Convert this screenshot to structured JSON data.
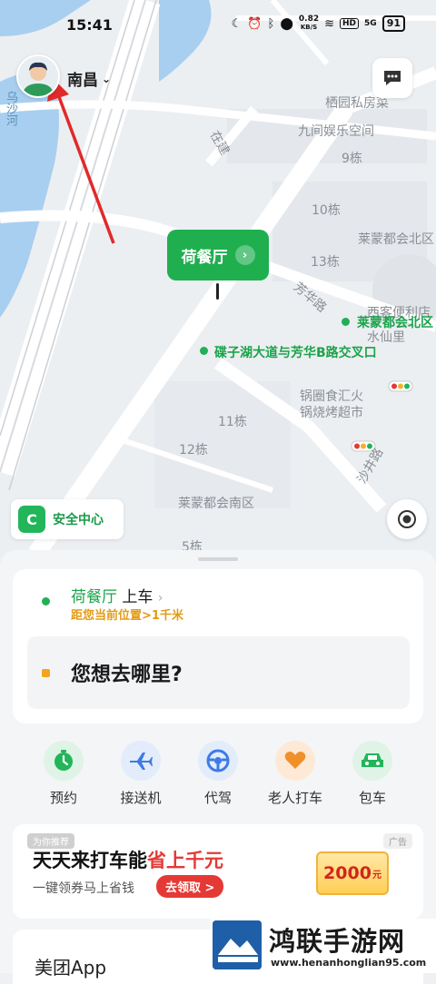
{
  "status_bar": {
    "time": "15:41",
    "net_speed_value": "0.82",
    "net_speed_unit": "KB/S",
    "hd": "HD",
    "signal": "5G",
    "battery": "91"
  },
  "header": {
    "city": "南昌"
  },
  "map": {
    "labels": {
      "river": "乌沙河",
      "road_vertical": "在建",
      "l1": "栖园私房菜",
      "l2": "九间娱乐空间",
      "l3": "9栋",
      "l4": "10栋",
      "l5": "莱蒙都会北区",
      "l6": "13栋",
      "l7": "芳华路",
      "l8": "西客便利店",
      "l9": "莱蒙都会北区",
      "l10": "水仙里",
      "l11": "碟子湖大道与芳华B路交叉口",
      "l12": "锅圈食汇火锅烧烤超市",
      "l13": "11栋",
      "l14": "12栋",
      "l15": "莱蒙都会南区",
      "l16": "沙井路",
      "l17": "5栋"
    },
    "pickup_bubble": "荷餐厅"
  },
  "safety": {
    "label": "安全中心"
  },
  "trip": {
    "from_name": "荷餐厅",
    "from_suffix": "上车",
    "from_distance": "距您当前位置>1千米",
    "dest_placeholder": "您想去哪里?"
  },
  "services": [
    {
      "label": "预约",
      "icon": "clock-icon",
      "color": "#22b55a"
    },
    {
      "label": "接送机",
      "icon": "plane-icon",
      "color": "#3d7be6"
    },
    {
      "label": "代驾",
      "icon": "steering-wheel-icon",
      "color": "#3d7be6"
    },
    {
      "label": "老人打车",
      "icon": "heart-hands-icon",
      "color": "#f0902a"
    },
    {
      "label": "包车",
      "icon": "car-icon",
      "color": "#22b55a"
    }
  ],
  "ad": {
    "tag_left": "为你推荐",
    "tag_right": "广告",
    "title_prefix": "天天来打车能",
    "title_highlight": "省上千元",
    "subtitle": "一键领券马上省钱",
    "button": "去领取 >",
    "coupon_value": "2000",
    "coupon_unit": "元"
  },
  "next_card": {
    "title": "美团App"
  },
  "watermark": {
    "title": "鸿联手游网",
    "url": "www.henanhonglian95.com"
  }
}
